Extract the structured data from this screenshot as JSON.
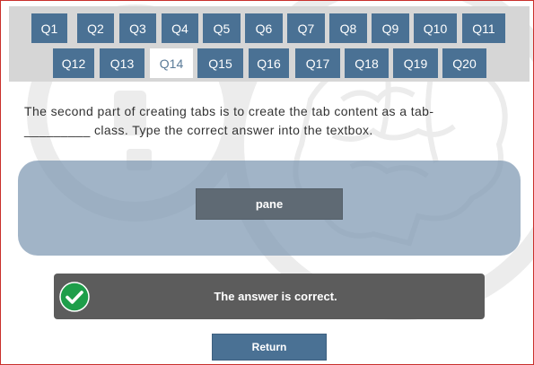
{
  "nav": {
    "tabs": [
      {
        "label": "Q1"
      },
      {
        "label": "Q2"
      },
      {
        "label": "Q3"
      },
      {
        "label": "Q4"
      },
      {
        "label": "Q5"
      },
      {
        "label": "Q6"
      },
      {
        "label": "Q7"
      },
      {
        "label": "Q8"
      },
      {
        "label": "Q9"
      },
      {
        "label": "Q10"
      },
      {
        "label": "Q11"
      },
      {
        "label": "Q12"
      },
      {
        "label": "Q13"
      },
      {
        "label": "Q14"
      },
      {
        "label": "Q15"
      },
      {
        "label": "Q16"
      },
      {
        "label": "Q17"
      },
      {
        "label": "Q18"
      },
      {
        "label": "Q19"
      },
      {
        "label": "Q20"
      }
    ],
    "active": "Q14"
  },
  "question": {
    "text": "The second part of creating tabs is to create the tab content as a tab-_________ class. Type the correct answer into the textbox."
  },
  "answer": {
    "value": "pane"
  },
  "feedback": {
    "text": "The answer is correct.",
    "status": "correct",
    "icon": "check-circle-icon",
    "icon_color": "#1e9e4a"
  },
  "actions": {
    "return_label": "Return"
  },
  "colors": {
    "tab_bg": "#4a7194",
    "nav_bg": "#d6d6d6",
    "panel_bg": "#829bb4",
    "feedback_bg": "#5c5c5c",
    "frame_border": "#c9302c"
  }
}
